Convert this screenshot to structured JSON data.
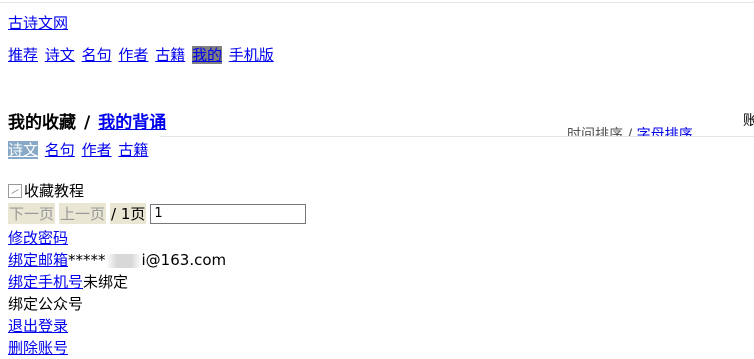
{
  "site": {
    "title": "古诗文网"
  },
  "nav": [
    {
      "label": "推荐",
      "active": false
    },
    {
      "label": "诗文",
      "active": false
    },
    {
      "label": "名句",
      "active": false
    },
    {
      "label": "作者",
      "active": false
    },
    {
      "label": "古籍",
      "active": false
    },
    {
      "label": "我的",
      "active": true
    },
    {
      "label": "手机版",
      "active": false
    }
  ],
  "heading": {
    "current": "我的收藏",
    "separator": "/",
    "other_link": "我的背诵"
  },
  "sort": {
    "time": "时间排序",
    "separator": "/",
    "alpha": "字母排序"
  },
  "cut_right_text": "账",
  "tabs": [
    {
      "label": "诗文",
      "active": true
    },
    {
      "label": "名句",
      "active": false
    },
    {
      "label": "作者",
      "active": false
    },
    {
      "label": "古籍",
      "active": false
    }
  ],
  "broken_image_alt": "收藏教程",
  "pager": {
    "next": "下一页",
    "prev": "上一页",
    "total": "/ 1页",
    "page_value": "1"
  },
  "account": {
    "change_password": "修改密码",
    "bind_email": "绑定邮箱",
    "email_prefix": "*****",
    "email_suffix": "i@163.com",
    "bind_phone": "绑定手机号",
    "phone_status": "未绑定",
    "bind_wechat": "绑定公众号",
    "logout": "退出登录",
    "delete_account": "删除账号"
  }
}
